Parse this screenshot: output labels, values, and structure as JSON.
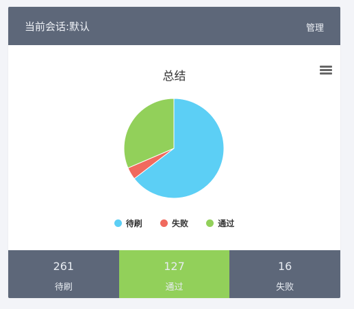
{
  "header": {
    "title": "当前会话:默认",
    "manage_label": "管理"
  },
  "chart": {
    "title": "总结",
    "menu_icon": "hamburger-menu-icon"
  },
  "chart_data": {
    "type": "pie",
    "title": "总结",
    "categories": [
      "待刷",
      "失败",
      "通过"
    ],
    "values": [
      261,
      16,
      127
    ],
    "colors": [
      "#5ccff5",
      "#f06a5e",
      "#92d05a"
    ],
    "legend_position": "bottom"
  },
  "legend": {
    "items": [
      {
        "label": "待刷",
        "color": "#5ccff5"
      },
      {
        "label": "失败",
        "color": "#f06a5e"
      },
      {
        "label": "通过",
        "color": "#92d05a"
      }
    ]
  },
  "stats": [
    {
      "value": "261",
      "label": "待刷",
      "bg": "#5d6779"
    },
    {
      "value": "127",
      "label": "通过",
      "bg": "#92d05a"
    },
    {
      "value": "16",
      "label": "失败",
      "bg": "#5d6779"
    }
  ]
}
